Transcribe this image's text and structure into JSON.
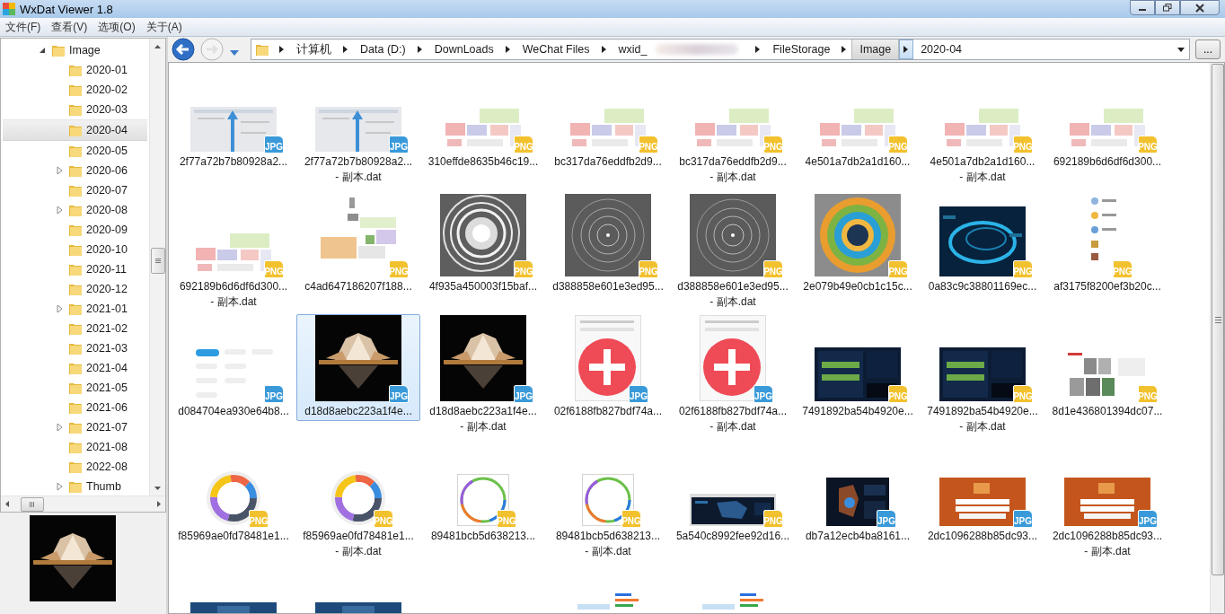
{
  "window": {
    "title": "WxDat Viewer 1.8"
  },
  "menu": [
    "文件(F)",
    "查看(V)",
    "选项(O)",
    "关于(A)"
  ],
  "tree": {
    "label": "Image",
    "expanded": true,
    "selected": false,
    "children": [
      {
        "label": "2020-01",
        "expandable": false,
        "expanded": false,
        "selected": false
      },
      {
        "label": "2020-02",
        "expandable": false,
        "expanded": false,
        "selected": false
      },
      {
        "label": "2020-03",
        "expandable": false,
        "expanded": false,
        "selected": false
      },
      {
        "label": "2020-04",
        "expandable": false,
        "expanded": false,
        "selected": true
      },
      {
        "label": "2020-05",
        "expandable": false,
        "expanded": false,
        "selected": false
      },
      {
        "label": "2020-06",
        "expandable": true,
        "expanded": false,
        "selected": false
      },
      {
        "label": "2020-07",
        "expandable": false,
        "expanded": false,
        "selected": false
      },
      {
        "label": "2020-08",
        "expandable": true,
        "expanded": false,
        "selected": false
      },
      {
        "label": "2020-09",
        "expandable": false,
        "expanded": false,
        "selected": false
      },
      {
        "label": "2020-10",
        "expandable": false,
        "expanded": false,
        "selected": false
      },
      {
        "label": "2020-11",
        "expandable": false,
        "expanded": false,
        "selected": false
      },
      {
        "label": "2020-12",
        "expandable": false,
        "expanded": false,
        "selected": false
      },
      {
        "label": "2021-01",
        "expandable": true,
        "expanded": false,
        "selected": false
      },
      {
        "label": "2021-02",
        "expandable": false,
        "expanded": false,
        "selected": false
      },
      {
        "label": "2021-03",
        "expandable": false,
        "expanded": false,
        "selected": false
      },
      {
        "label": "2021-04",
        "expandable": false,
        "expanded": false,
        "selected": false
      },
      {
        "label": "2021-05",
        "expandable": false,
        "expanded": false,
        "selected": false
      },
      {
        "label": "2021-06",
        "expandable": false,
        "expanded": false,
        "selected": false
      },
      {
        "label": "2021-07",
        "expandable": true,
        "expanded": false,
        "selected": false
      },
      {
        "label": "2021-08",
        "expandable": false,
        "expanded": false,
        "selected": false
      },
      {
        "label": "2022-08",
        "expandable": false,
        "expanded": false,
        "selected": false
      },
      {
        "label": "Thumb",
        "expandable": true,
        "expanded": false,
        "selected": false
      }
    ]
  },
  "address": {
    "segments": [
      {
        "label": "计算机",
        "highlighted": false,
        "redacted": false
      },
      {
        "label": "Data (D:)",
        "highlighted": false,
        "redacted": false
      },
      {
        "label": "DownLoads",
        "highlighted": false,
        "redacted": false
      },
      {
        "label": "WeChat Files",
        "highlighted": false,
        "redacted": false
      },
      {
        "label": "wxid_",
        "highlighted": false,
        "redacted": true
      },
      {
        "label": "FileStorage",
        "highlighted": false,
        "redacted": false
      },
      {
        "label": "Image",
        "highlighted": true,
        "redacted": false
      }
    ],
    "current": "2020-04",
    "more_button": "..."
  },
  "files": [
    {
      "lines": [
        "2f77a72b7b80928a2..."
      ],
      "badge": "JPG",
      "kind": "jpg",
      "selected": false,
      "picture": true
    },
    {
      "lines": [
        "2f77a72b7b80928a2...",
        "- 副本.dat"
      ],
      "badge": "JPG",
      "kind": "jpg",
      "selected": false,
      "picture": true
    },
    {
      "lines": [
        "310effde8635b46c19..."
      ],
      "badge": "PNG",
      "kind": "png",
      "selected": false,
      "picture": true
    },
    {
      "lines": [
        "bc317da76eddfb2d9..."
      ],
      "badge": "PNG",
      "kind": "png",
      "selected": false,
      "picture": true
    },
    {
      "lines": [
        "bc317da76eddfb2d9...",
        "- 副本.dat"
      ],
      "badge": "PNG",
      "kind": "png",
      "selected": false,
      "picture": true
    },
    {
      "lines": [
        "4e501a7db2a1d160..."
      ],
      "badge": "PNG",
      "kind": "png",
      "selected": false,
      "picture": true
    },
    {
      "lines": [
        "4e501a7db2a1d160...",
        "- 副本.dat"
      ],
      "badge": "PNG",
      "kind": "png",
      "selected": false,
      "picture": true
    },
    {
      "lines": [
        "692189b6d6df6d300..."
      ],
      "badge": "PNG",
      "kind": "png",
      "selected": false,
      "picture": true
    },
    {
      "lines": [
        "692189b6d6df6d300...",
        "- 副本.dat"
      ],
      "badge": "PNG",
      "kind": "png",
      "selected": false,
      "picture": true
    },
    {
      "lines": [
        "c4ad647186207f188..."
      ],
      "badge": "PNG",
      "kind": "png",
      "selected": false,
      "picture": true
    },
    {
      "lines": [
        "4f935a450003f15baf..."
      ],
      "badge": "PNG",
      "kind": "png",
      "selected": false,
      "picture": true
    },
    {
      "lines": [
        "d388858e601e3ed95..."
      ],
      "badge": "PNG",
      "kind": "png",
      "selected": false,
      "picture": true
    },
    {
      "lines": [
        "d388858e601e3ed95...",
        "- 副本.dat"
      ],
      "badge": "PNG",
      "kind": "png",
      "selected": false,
      "picture": true
    },
    {
      "lines": [
        "2e079b49e0cb1c15c..."
      ],
      "badge": "PNG",
      "kind": "png",
      "selected": false,
      "picture": true
    },
    {
      "lines": [
        "0a83c9c38801169ec..."
      ],
      "badge": "PNG",
      "kind": "png",
      "selected": false,
      "picture": true
    },
    {
      "lines": [
        "af3175f8200ef3b20c..."
      ],
      "badge": "PNG",
      "kind": "png",
      "selected": false,
      "picture": true
    },
    {
      "lines": [
        "d084704ea930e64b8..."
      ],
      "badge": "JPG",
      "kind": "jpg",
      "selected": false,
      "picture": true
    },
    {
      "lines": [
        "d18d8aebc223a1f4e..."
      ],
      "badge": "JPG",
      "kind": "jpg",
      "selected": true,
      "picture": true
    },
    {
      "lines": [
        "d18d8aebc223a1f4e...",
        "- 副本.dat"
      ],
      "badge": "JPG",
      "kind": "jpg",
      "selected": false,
      "picture": true
    },
    {
      "lines": [
        "02f6188fb827bdf74a..."
      ],
      "badge": "JPG",
      "kind": "jpg",
      "selected": false,
      "picture": true
    },
    {
      "lines": [
        "02f6188fb827bdf74a...",
        "- 副本.dat"
      ],
      "badge": "JPG",
      "kind": "jpg",
      "selected": false,
      "picture": true
    },
    {
      "lines": [
        "7491892ba54b4920e..."
      ],
      "badge": "PNG",
      "kind": "png",
      "selected": false,
      "picture": true
    },
    {
      "lines": [
        "7491892ba54b4920e...",
        "- 副本.dat"
      ],
      "badge": "PNG",
      "kind": "png",
      "selected": false,
      "picture": true
    },
    {
      "lines": [
        "8d1e436801394dc07..."
      ],
      "badge": "PNG",
      "kind": "png",
      "selected": false,
      "picture": true
    },
    {
      "lines": [
        "f85969ae0fd78481e1..."
      ],
      "badge": "PNG",
      "kind": "png",
      "selected": false,
      "picture": true
    },
    {
      "lines": [
        "f85969ae0fd78481e1...",
        "- 副本.dat"
      ],
      "badge": "PNG",
      "kind": "png",
      "selected": false,
      "picture": true
    },
    {
      "lines": [
        "89481bcb5d638213..."
      ],
      "badge": "PNG",
      "kind": "png",
      "selected": false,
      "picture": true
    },
    {
      "lines": [
        "89481bcb5d638213...",
        "- 副本.dat"
      ],
      "badge": "PNG",
      "kind": "png",
      "selected": false,
      "picture": true
    },
    {
      "lines": [
        "5a540c8992fee92d16..."
      ],
      "badge": "PNG",
      "kind": "png",
      "selected": false,
      "picture": true
    },
    {
      "lines": [
        "db7a12ecb4ba8161..."
      ],
      "badge": "JPG",
      "kind": "jpg",
      "selected": false,
      "picture": true
    },
    {
      "lines": [
        "2dc1096288b85dc93..."
      ],
      "badge": "JPG",
      "kind": "jpg",
      "selected": false,
      "picture": true
    },
    {
      "lines": [
        "2dc1096288b85dc93...",
        "- 副本.dat"
      ],
      "badge": "JPG",
      "kind": "jpg",
      "selected": false,
      "picture": true
    },
    {
      "selected": false,
      "picture": true
    },
    {
      "selected": false,
      "picture": true
    },
    {
      "picture": false
    },
    {
      "selected": false,
      "picture": true
    },
    {
      "selected": false,
      "picture": true
    }
  ]
}
